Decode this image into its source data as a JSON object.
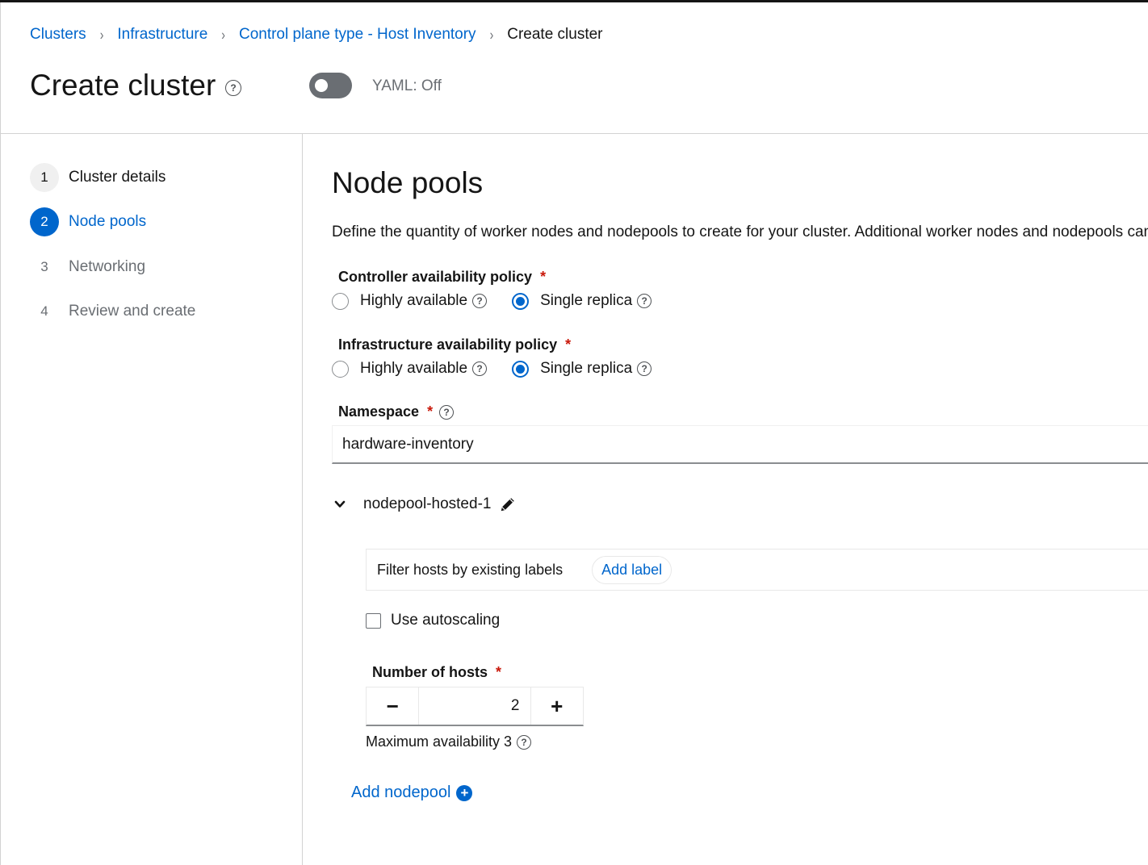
{
  "breadcrumb": {
    "items": [
      "Clusters",
      "Infrastructure",
      "Control plane type - Host Inventory"
    ],
    "current": "Create cluster",
    "separator": "›"
  },
  "header": {
    "title": "Create cluster",
    "help_glyph": "?",
    "yaml_toggle": {
      "label": "YAML: Off",
      "on": false
    }
  },
  "wizard": {
    "steps": [
      {
        "number": "1",
        "label": "Cluster details",
        "state": "done"
      },
      {
        "number": "2",
        "label": "Node pools",
        "state": "active"
      },
      {
        "number": "3",
        "label": "Networking",
        "state": "pending"
      },
      {
        "number": "4",
        "label": "Review and create",
        "state": "pending"
      }
    ]
  },
  "main": {
    "title": "Node pools",
    "description": "Define the quantity of worker nodes and nodepools to create for your cluster. Additional worker nodes and nodepools can be created after the cluster is created.",
    "controller_policy": {
      "label": "Controller availability policy",
      "required": "*",
      "options": [
        {
          "label": "Highly available",
          "checked": false
        },
        {
          "label": "Single replica",
          "checked": true
        }
      ]
    },
    "infrastructure_policy": {
      "label": "Infrastructure availability policy",
      "required": "*",
      "options": [
        {
          "label": "Highly available",
          "checked": false
        },
        {
          "label": "Single replica",
          "checked": true
        }
      ]
    },
    "namespace": {
      "label": "Namespace",
      "required": "*",
      "value": "hardware-inventory"
    },
    "nodepool": {
      "name": "nodepool-hosted-1",
      "filter_label": "Filter hosts by existing labels",
      "add_label": "Add label",
      "autoscaling_label": "Use autoscaling",
      "autoscaling_checked": false,
      "hosts_label": "Number of hosts",
      "hosts_required": "*",
      "hosts_value": "2",
      "minus": "−",
      "plus": "+",
      "max_availability": "Maximum availability 3"
    },
    "add_nodepool": "Add nodepool"
  },
  "colors": {
    "link": "#0066cc",
    "required": "#c9190b",
    "toggle_off": "#6a6e73",
    "text": "#151515"
  },
  "icons": [
    "help-icon",
    "chevron-down-icon",
    "pencil-icon",
    "plus-circle-icon"
  ]
}
